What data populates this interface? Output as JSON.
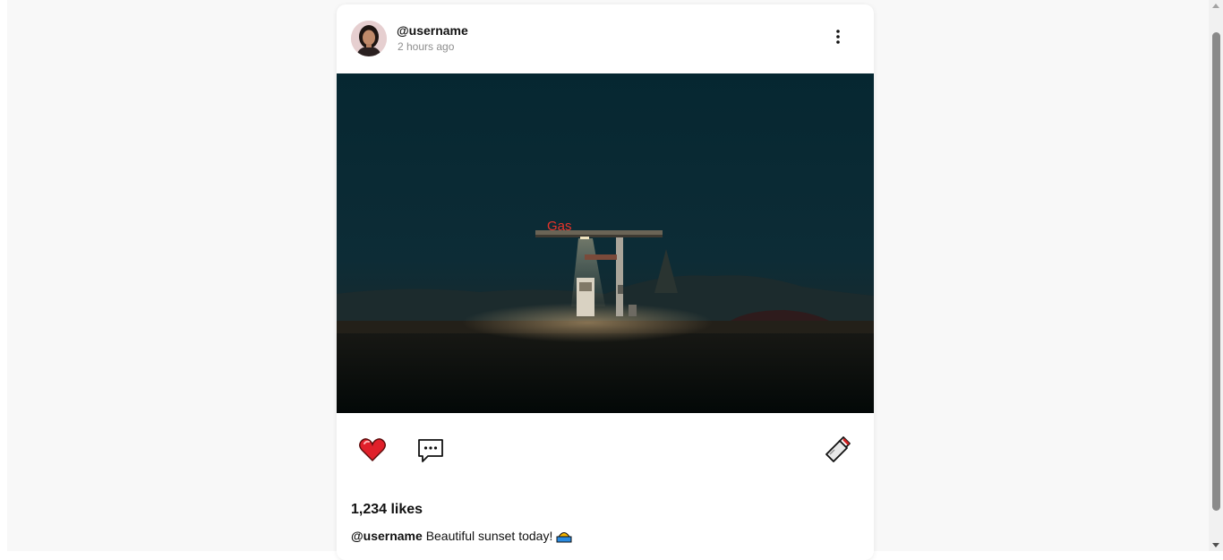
{
  "post": {
    "author": {
      "username": "@username",
      "avatar_icon": "avatar-photo"
    },
    "timestamp": "2 hours ago",
    "menu_icon": "more-vertical-icon",
    "image": {
      "sign_text": "Gas"
    },
    "actions": {
      "like_icon": "heart-icon",
      "comment_icon": "comment-icon",
      "save_icon": "bookmark-icon"
    },
    "likes": "1,234 likes",
    "caption": {
      "username": "@username",
      "text": "Beautiful sunset today!",
      "emoji_icon": "sunset-emoji-icon"
    },
    "colors": {
      "like": "#e0202a",
      "sign": "#e8342a",
      "sky": "#0d2c36"
    }
  }
}
